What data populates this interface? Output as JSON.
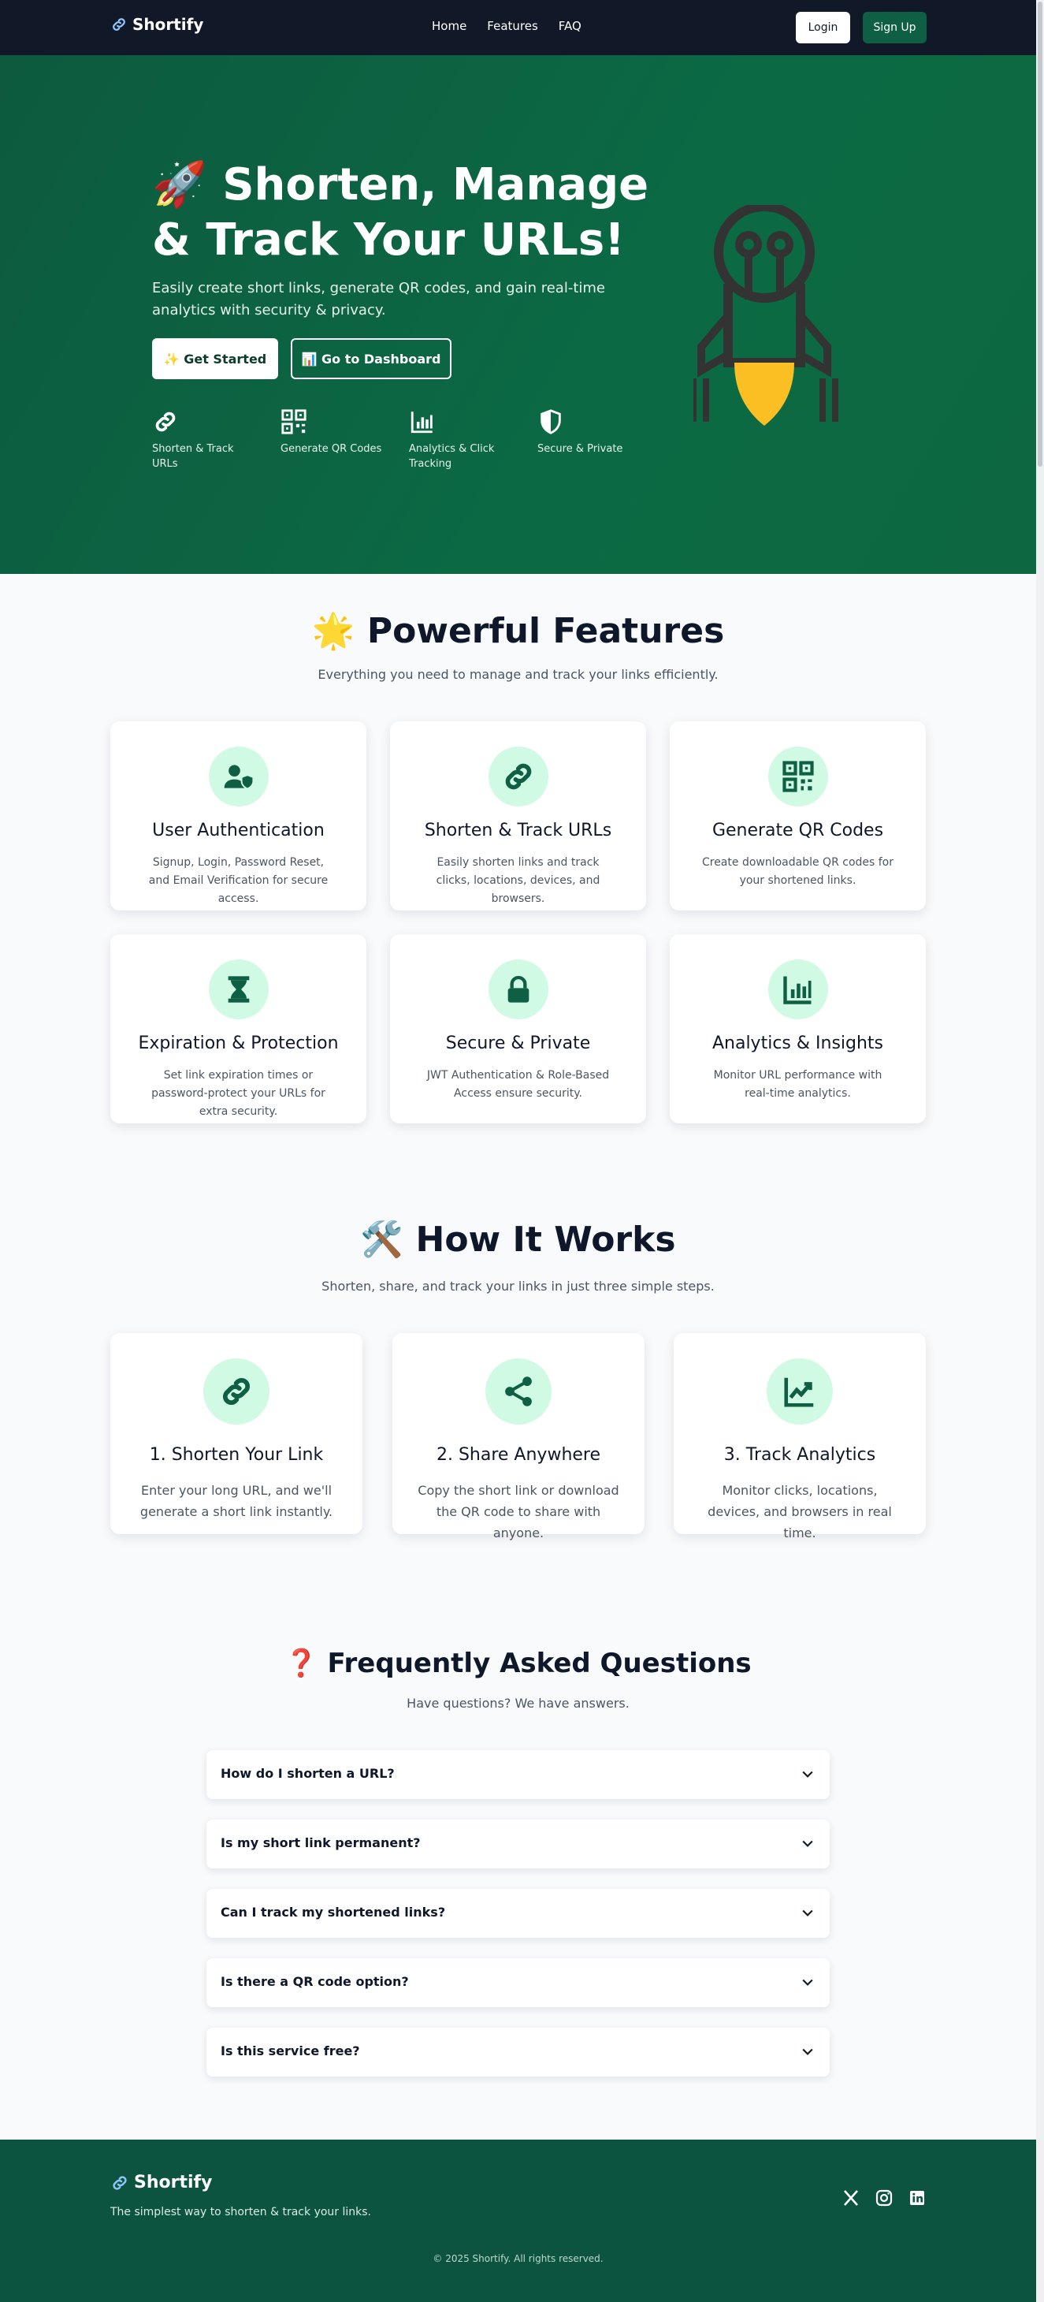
{
  "nav": {
    "brand": "Shortify",
    "links": [
      "Home",
      "Features",
      "FAQ"
    ],
    "login": "Login",
    "signup": "Sign Up"
  },
  "hero": {
    "title": "🚀 Shorten, Manage & Track Your URLs!",
    "subtitle": "Easily create short links, generate QR codes, and gain real-time analytics with security & privacy.",
    "cta_primary": "✨ Get Started",
    "cta_secondary": "📊 Go to Dashboard",
    "features": [
      {
        "label": "Shorten & Track URLs",
        "icon": "link-icon"
      },
      {
        "label": "Generate QR Codes",
        "icon": "qr-code-icon"
      },
      {
        "label": "Analytics & Click Tracking",
        "icon": "bar-chart-icon"
      },
      {
        "label": "Secure & Private",
        "icon": "shield-icon"
      }
    ]
  },
  "features": {
    "title": "🌟 Powerful Features",
    "subtitle": "Everything you need to manage and track your links efficiently.",
    "cards": [
      {
        "title": "User Authentication",
        "desc": "Signup, Login, Password Reset, and Email Verification for secure access.",
        "icon": "user-shield-icon"
      },
      {
        "title": "Shorten & Track URLs",
        "desc": "Easily shorten links and track clicks, locations, devices, and browsers.",
        "icon": "link-icon"
      },
      {
        "title": "Generate QR Codes",
        "desc": "Create downloadable QR codes for your shortened links.",
        "icon": "qr-code-icon"
      },
      {
        "title": "Expiration & Protection",
        "desc": "Set link expiration times or password-protect your URLs for extra security.",
        "icon": "hourglass-icon"
      },
      {
        "title": "Secure & Private",
        "desc": "JWT Authentication & Role-Based Access ensure security.",
        "icon": "lock-icon"
      },
      {
        "title": "Analytics & Insights",
        "desc": "Monitor URL performance with real-time analytics.",
        "icon": "bar-chart-icon"
      }
    ]
  },
  "how": {
    "title": "🛠️ How It Works",
    "subtitle": "Shorten, share, and track your links in just three simple steps.",
    "steps": [
      {
        "title": "1. Shorten Your Link",
        "desc": "Enter your long URL, and we'll generate a short link instantly.",
        "icon": "link-icon"
      },
      {
        "title": "2. Share Anywhere",
        "desc": "Copy the short link or download the QR code to share with anyone.",
        "icon": "share-icon"
      },
      {
        "title": "3. Track Analytics",
        "desc": "Monitor clicks, locations, devices, and browsers in real time.",
        "icon": "trend-chart-icon"
      }
    ]
  },
  "faq": {
    "title": "❓ Frequently Asked Questions",
    "subtitle": "Have questions? We have answers.",
    "items": [
      "How do I shorten a URL?",
      "Is my short link permanent?",
      "Can I track my shortened links?",
      "Is there a QR code option?",
      "Is this service free?"
    ]
  },
  "footer": {
    "brand": "Shortify",
    "tagline": "The simplest way to shorten & track your links.",
    "copyright": "© 2025 Shortify. All rights reserved.",
    "social": [
      "x-icon",
      "instagram-icon",
      "linkedin-icon"
    ]
  },
  "colors": {
    "nav_bg": "#111827",
    "hero_green": "#0b6a44",
    "accent": "#0f5f45",
    "icon_circle": "#d1fae5",
    "footer_bg": "#0d5440"
  }
}
